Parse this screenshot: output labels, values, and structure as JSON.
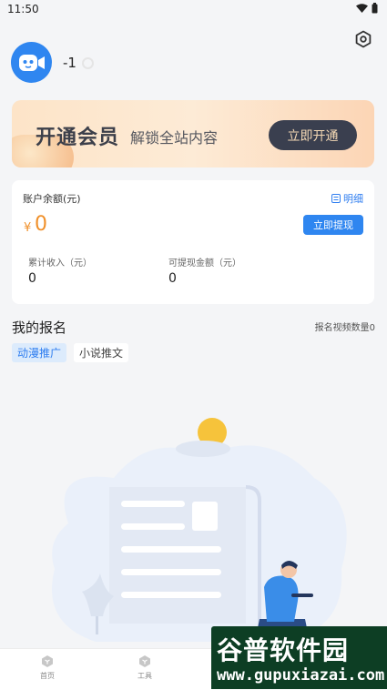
{
  "status_bar": {
    "time": "11:50",
    "wifi_icon": "wifi-icon",
    "battery_icon": "battery-icon"
  },
  "profile": {
    "username": "-1",
    "avatar_icon": "robot-camera-icon",
    "settings_icon": "settings-icon"
  },
  "vip_banner": {
    "title": "开通会员",
    "subtitle": "解锁全站内容",
    "button_label": "立即开通"
  },
  "balance": {
    "label": "账户余额(元)",
    "detail_label": "明细",
    "currency_symbol": "¥",
    "amount": "0",
    "withdraw_label": "立即提现",
    "cumulative_income_label": "累计收入（元）",
    "cumulative_income_value": "0",
    "withdrawable_label": "可提现金额（元）",
    "withdrawable_value": "0"
  },
  "my_signup": {
    "title": "我的报名",
    "count_label": "报名视频数量0",
    "tabs": [
      {
        "label": "动漫推广",
        "active": true
      },
      {
        "label": "小说推文",
        "active": false
      }
    ]
  },
  "bottom_nav": {
    "items": [
      {
        "label": "首页",
        "icon": "home-cube-icon"
      },
      {
        "label": "工具",
        "icon": "tool-cube-icon"
      }
    ]
  },
  "watermark": {
    "title": "谷普软件园",
    "url": "www.gupuxiazai.com"
  },
  "colors": {
    "accent": "#2f86f0",
    "amount": "#f0902a",
    "vip_button": "#3a3f4f"
  }
}
